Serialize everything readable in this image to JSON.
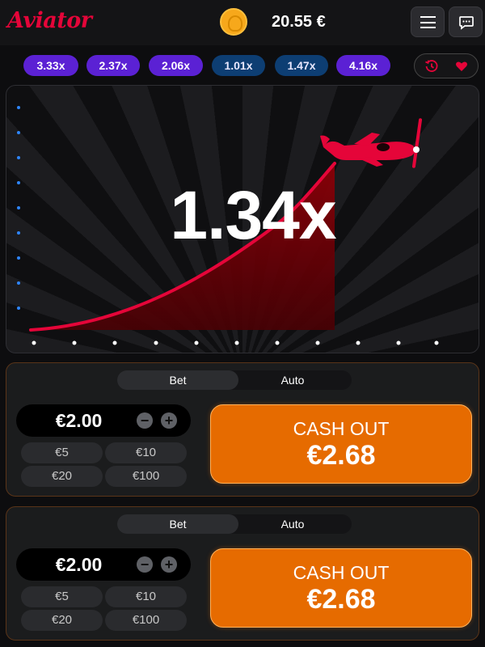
{
  "header": {
    "logo": "Aviator",
    "balance": "20.55 €"
  },
  "multipliers": [
    {
      "value": "3.33x",
      "color": "#5b21d4"
    },
    {
      "value": "2.37x",
      "color": "#5b21d4"
    },
    {
      "value": "2.06x",
      "color": "#5b21d4"
    },
    {
      "value": "1.01x",
      "color": "#0d3e73"
    },
    {
      "value": "1.47x",
      "color": "#0d3e73"
    },
    {
      "value": "4.16x",
      "color": "#5b21d4"
    }
  ],
  "game": {
    "multiplier": "1.34x",
    "accent": "#e50539"
  },
  "panels": [
    {
      "tabs": {
        "bet": "Bet",
        "auto": "Auto"
      },
      "amount": "€2.00",
      "quick": [
        "€5",
        "€10",
        "€20",
        "€100"
      ],
      "cashout_label": "CASH OUT",
      "cashout_amount": "€2.68"
    },
    {
      "tabs": {
        "bet": "Bet",
        "auto": "Auto"
      },
      "amount": "€2.00",
      "quick": [
        "€5",
        "€10",
        "€20",
        "€100"
      ],
      "cashout_label": "CASH OUT",
      "cashout_amount": "€2.68"
    }
  ],
  "colors": {
    "brand": "#e50539",
    "cashout": "#e66b00"
  }
}
